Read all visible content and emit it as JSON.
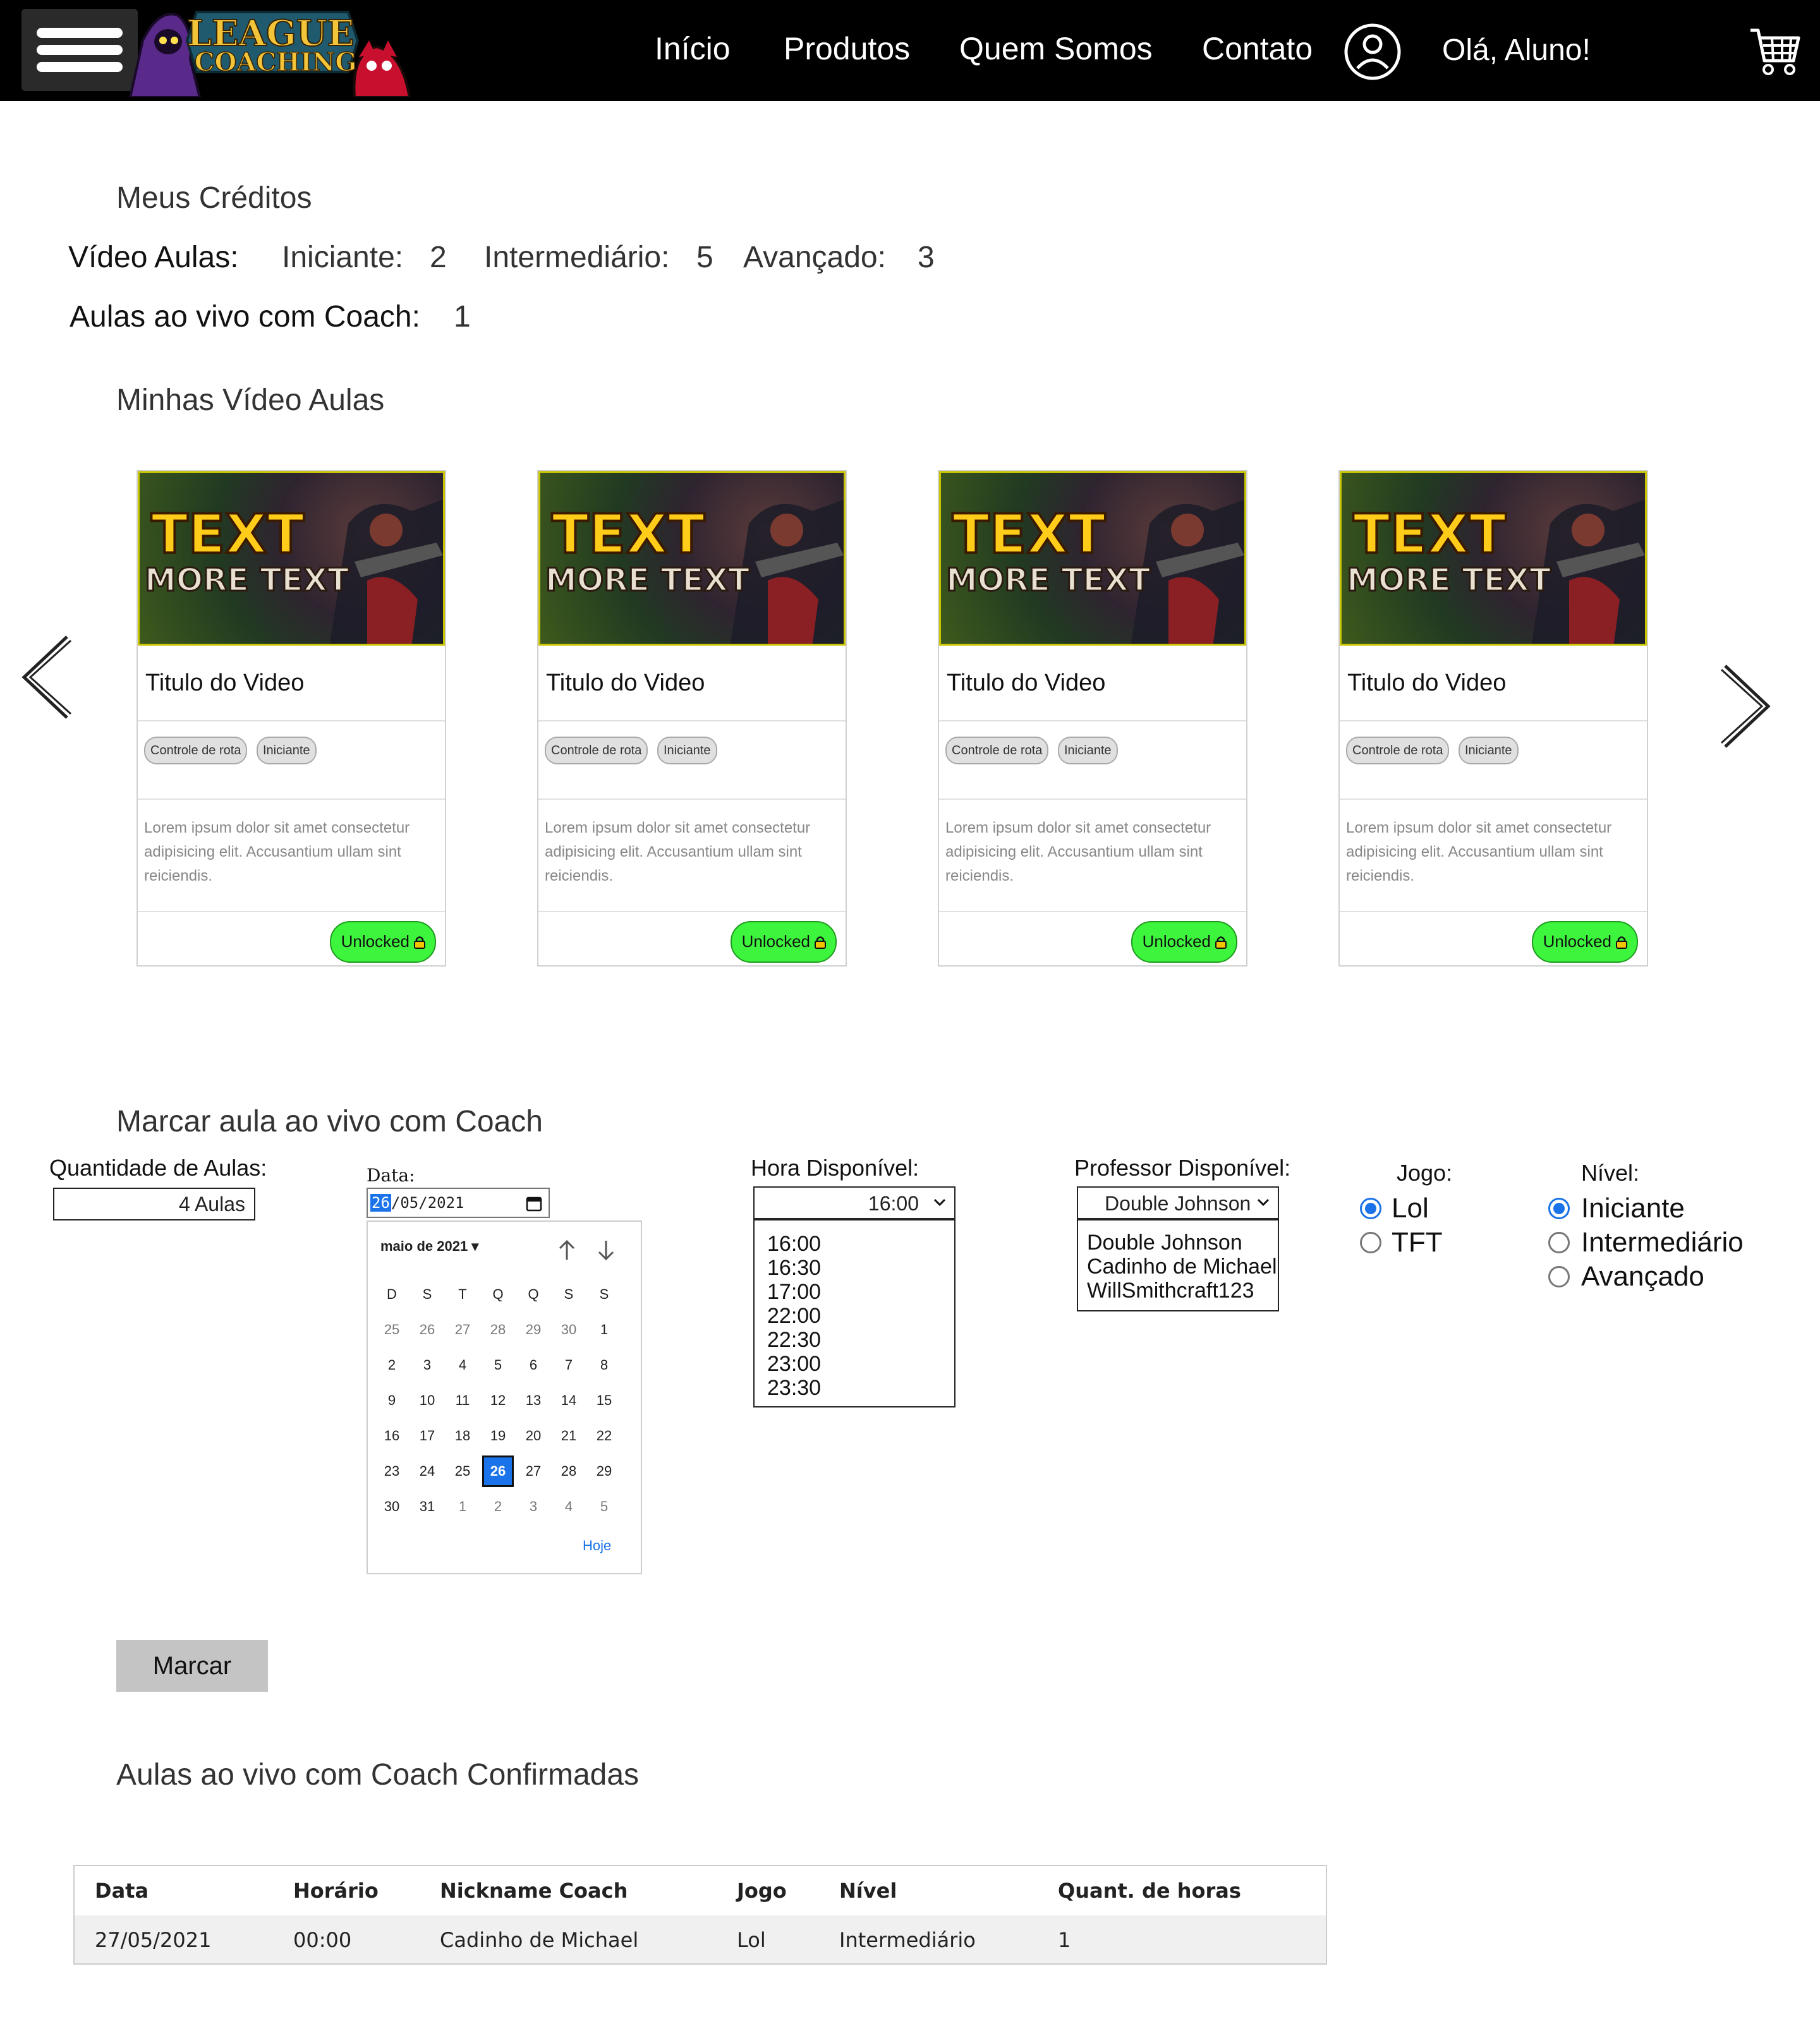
{
  "nav": {
    "logo_text_top": "LEAGUE",
    "logo_text_bottom": "COACHING",
    "links": [
      "Início",
      "Produtos",
      "Quem Somos",
      "Contato"
    ],
    "greeting": "Olá, Aluno!"
  },
  "credits": {
    "title": "Meus Créditos",
    "video_label": "Vídeo Aulas:",
    "beginner_label": "Iniciante:",
    "beginner_value": "2",
    "intermediate_label": "Intermediário:",
    "intermediate_value": "5",
    "advanced_label": "Avançado:",
    "advanced_value": "3",
    "live_label": "Aulas ao vivo com Coach:",
    "live_value": "1"
  },
  "videos": {
    "title": "Minhas Vídeo Aulas",
    "thumb_text_1": "TEXT",
    "thumb_text_2": "MORE TEXT",
    "cards": [
      {
        "title": "Titulo do Video",
        "tags": [
          "Controle de rota",
          "Iniciante"
        ],
        "desc": "Lorem ipsum dolor sit amet consectetur adipisicing elit. Accusantium ullam sint reiciendis.",
        "button": "Unlocked"
      },
      {
        "title": "Titulo do Video",
        "tags": [
          "Controle de rota",
          "Iniciante"
        ],
        "desc": "Lorem ipsum dolor sit amet consectetur adipisicing elit. Accusantium ullam sint reiciendis.",
        "button": "Unlocked"
      },
      {
        "title": "Titulo do Video",
        "tags": [
          "Controle de rota",
          "Iniciante"
        ],
        "desc": "Lorem ipsum dolor sit amet consectetur adipisicing elit. Accusantium ullam sint reiciendis.",
        "button": "Unlocked"
      },
      {
        "title": "Titulo do Video",
        "tags": [
          "Controle de rota",
          "Iniciante"
        ],
        "desc": "Lorem ipsum dolor sit amet consectetur adipisicing elit. Accusantium ullam sint reiciendis.",
        "button": "Unlocked"
      }
    ]
  },
  "booking": {
    "title": "Marcar aula ao vivo com Coach",
    "qty_label": "Quantidade de Aulas:",
    "qty_value": "4 Aulas",
    "date_label": "Data:",
    "date_day": "26",
    "date_rest": "/05/2021",
    "calendar": {
      "month": "maio de 2021",
      "weekdays": [
        "D",
        "S",
        "T",
        "Q",
        "Q",
        "S",
        "S"
      ],
      "weeks": [
        [
          "25",
          "26",
          "27",
          "28",
          "29",
          "30",
          "1"
        ],
        [
          "2",
          "3",
          "4",
          "5",
          "6",
          "7",
          "8"
        ],
        [
          "9",
          "10",
          "11",
          "12",
          "13",
          "14",
          "15"
        ],
        [
          "16",
          "17",
          "18",
          "19",
          "20",
          "21",
          "22"
        ],
        [
          "23",
          "24",
          "25",
          "26",
          "27",
          "28",
          "29"
        ],
        [
          "30",
          "31",
          "1",
          "2",
          "3",
          "4",
          "5"
        ]
      ],
      "selected": "26",
      "today": "Hoje"
    },
    "hour_label": "Hora Disponível:",
    "hour_selected": "16:00",
    "hours": [
      "16:00",
      "16:30",
      "17:00",
      "22:00",
      "22:30",
      "23:00",
      "23:30"
    ],
    "teacher_label": "Professor Disponível:",
    "teacher_selected": "Double Johnson",
    "teachers": [
      "Double Johnson",
      "Cadinho de Michael",
      "WillSmithcraft123"
    ],
    "game_label": "Jogo:",
    "games": [
      "Lol",
      "TFT"
    ],
    "game_selected": "Lol",
    "level_label": "Nível:",
    "levels": [
      "Iniciante",
      "Intermediário",
      "Avançado"
    ],
    "level_selected": "Iniciante",
    "submit": "Marcar"
  },
  "confirmed": {
    "title": "Aulas ao vivo com Coach Confirmadas",
    "headers": [
      "Data",
      "Horário",
      "Nickname Coach",
      "Jogo",
      "Nível",
      "Quant. de horas"
    ],
    "rows": [
      [
        "27/05/2021",
        "00:00",
        "Cadinho de Michael",
        "Lol",
        "Intermediário",
        "1"
      ]
    ]
  },
  "colors": {
    "navbar": "#000000",
    "unlock_green": "#3df53d",
    "accent_blue": "#1a73e8",
    "thumb_border": "#c8c400",
    "submit_gray": "#c4c4c4"
  }
}
